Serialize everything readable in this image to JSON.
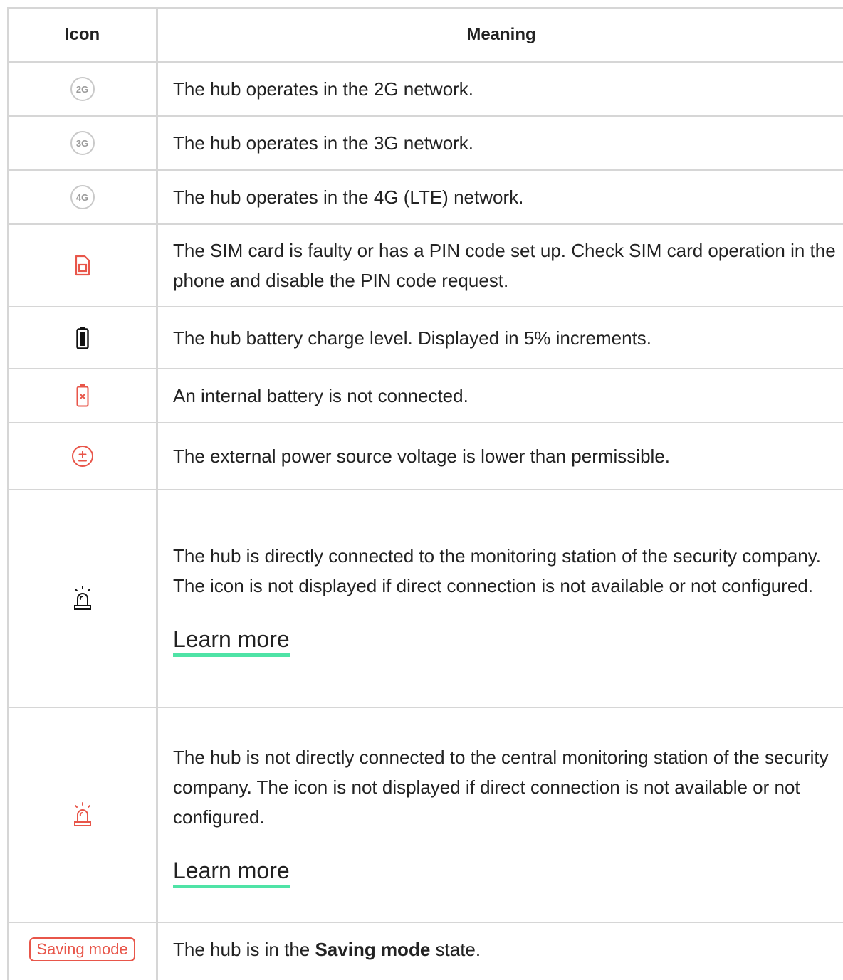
{
  "table": {
    "headers": {
      "icon": "Icon",
      "meaning": "Meaning"
    },
    "rows": [
      {
        "icon": "2g-network-icon",
        "icon_text": "2G",
        "meaning": "The hub operates in the 2G network."
      },
      {
        "icon": "3g-network-icon",
        "icon_text": "3G",
        "meaning": "The hub operates in the 3G network."
      },
      {
        "icon": "4g-network-icon",
        "icon_text": "4G",
        "meaning": "The hub operates in the 4G (LTE) network."
      },
      {
        "icon": "sim-card-fault-icon",
        "meaning": "The SIM card is faulty or has a PIN code set up. Check SIM card operation in the phone and disable the PIN code request."
      },
      {
        "icon": "battery-level-icon",
        "meaning": "The hub battery charge level. Displayed in 5% increments."
      },
      {
        "icon": "battery-disconnected-icon",
        "meaning": "An internal battery is not connected."
      },
      {
        "icon": "low-voltage-icon",
        "meaning": "The external power source voltage is lower than permissible."
      },
      {
        "icon": "monitoring-connected-icon",
        "meaning": "The hub is directly connected to the monitoring station of the security company. The icon is not displayed if direct connection is not available or not configured.",
        "link": "Learn more"
      },
      {
        "icon": "monitoring-disconnected-icon",
        "meaning": "The hub is not directly connected to the central monitoring station of the security company. The icon is not displayed if direct connection is not available or not configured.",
        "link": "Learn more"
      },
      {
        "icon": "saving-mode-badge",
        "badge_text": "Saving mode",
        "meaning_prefix": "The hub is in the ",
        "meaning_bold": "Saving mode",
        "meaning_suffix": " state."
      }
    ]
  },
  "colors": {
    "alert_red": "#e8564a",
    "link_underline": "#4fe3a6",
    "border": "#d6d6d6",
    "icon_grey": "#c9c9c9"
  }
}
